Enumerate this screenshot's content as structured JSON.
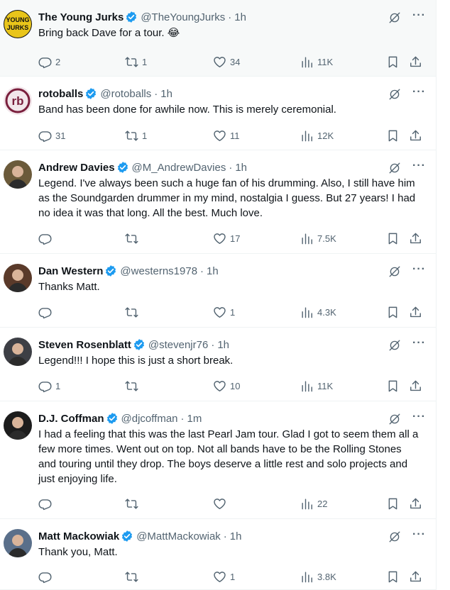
{
  "tweets": [
    {
      "name": "The Young Jurks",
      "handle": "@TheYoungJurks",
      "time": "1h",
      "text": "Bring back Dave for a tour. 😂",
      "replies": "2",
      "retweets": "1",
      "likes": "34",
      "views": "11K",
      "avatar_color": "#e9c51a",
      "avatar_text": "YOUNG JURKS",
      "verified": true
    },
    {
      "name": "rotoballs",
      "handle": "@rotoballs",
      "time": "1h",
      "text": "Band has been done for awhile now. This is merely ceremonial.",
      "replies": "31",
      "retweets": "1",
      "likes": "11",
      "views": "12K",
      "avatar_color": "#f2e6ea",
      "avatar_text": "rb",
      "verified": true
    },
    {
      "name": "Andrew Davies",
      "handle": "@M_AndrewDavies",
      "time": "1h",
      "text": "Legend. I've always been such a huge fan of his drumming. Also, I still have him as the Soundgarden drummer in my mind, nostalgia I guess. But 27 years! I had no idea it was that long. All the best. Much love.",
      "replies": "",
      "retweets": "",
      "likes": "17",
      "views": "7.5K",
      "avatar_color": "#6b5a3a",
      "verified": true
    },
    {
      "name": "Dan Western",
      "handle": "@westerns1978",
      "time": "1h",
      "text": "Thanks Matt.",
      "replies": "",
      "retweets": "",
      "likes": "1",
      "views": "4.3K",
      "avatar_color": "#5a3a2a",
      "verified": true
    },
    {
      "name": "Steven Rosenblatt",
      "handle": "@stevenjr76",
      "time": "1h",
      "text": "Legend!!!  I hope this is just a short break.",
      "replies": "1",
      "retweets": "",
      "likes": "10",
      "views": "11K",
      "avatar_color": "#3d3f45",
      "verified": true
    },
    {
      "name": "D.J. Coffman",
      "handle": "@djcoffman",
      "time": "1m",
      "text": "I had a feeling that this was the last Pearl Jam tour. Glad I got to seem them all a few more times. Went out on top. Not all bands have to be the Rolling Stones and touring until they drop. The boys deserve a little rest and solo projects and just enjoying life.",
      "replies": "",
      "retweets": "",
      "likes": "",
      "views": "22",
      "avatar_color": "#1c1c1c",
      "verified": true
    },
    {
      "name": "Matt Mackowiak",
      "handle": "@MattMackowiak",
      "time": "1h",
      "text": "Thank you, Matt.",
      "replies": "",
      "retweets": "",
      "likes": "1",
      "views": "3.8K",
      "avatar_color": "#5a6f8a",
      "verified": true
    }
  ],
  "colors": {
    "accent": "#1d9bf0",
    "muted": "#536471",
    "text": "#0f1419",
    "highlight_bg": "#f7f9f9"
  },
  "icons": {
    "more": "···"
  }
}
